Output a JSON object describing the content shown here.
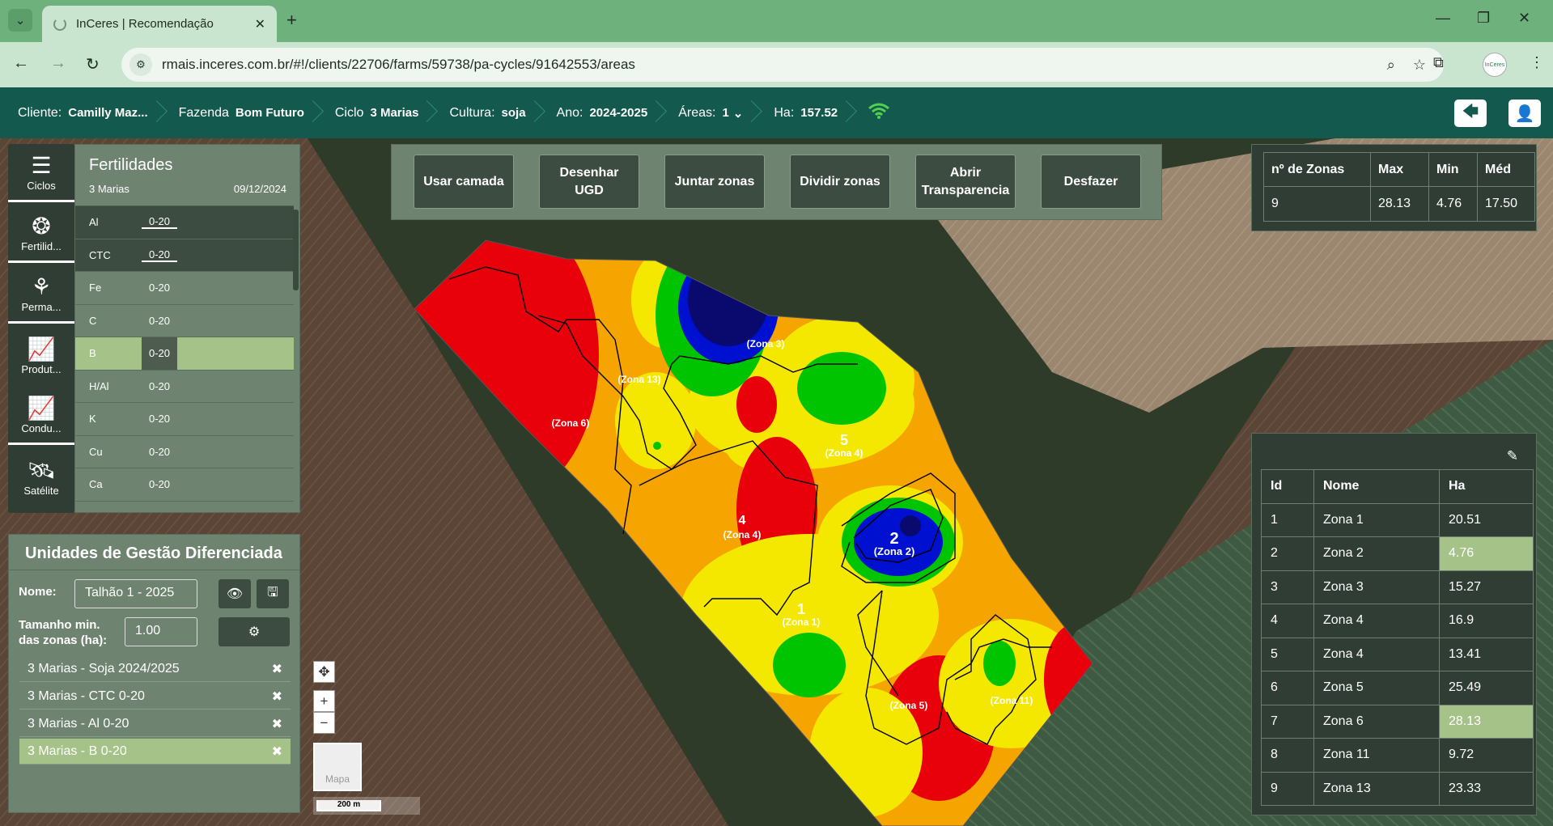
{
  "browser": {
    "tab_title": "InCeres | Recomendação",
    "url": "rmais.inceres.com.br/#!/clients/22706/farms/59738/pa-cycles/91642553/areas",
    "profile_label": "InCeres"
  },
  "header": {
    "cliente_label": "Cliente:",
    "cliente_value": "Camilly Maz...",
    "fazenda_label": "Fazenda",
    "fazenda_value": "Bom Futuro",
    "ciclo_label": "Ciclo",
    "ciclo_value": "3 Marias",
    "cultura_label": "Cultura:",
    "cultura_value": "soja",
    "ano_label": "Ano:",
    "ano_value": "2024-2025",
    "areas_label": "Áreas:",
    "areas_value": "1",
    "ha_label": "Ha:",
    "ha_value": "157.52"
  },
  "leftnav": {
    "items": [
      {
        "label": "Ciclos",
        "icon": "list-icon"
      },
      {
        "label": "Fertilid...",
        "icon": "sprout-icon"
      },
      {
        "label": "Perma...",
        "icon": "plants-icon"
      },
      {
        "label": "Produt...",
        "icon": "chart-icon"
      },
      {
        "label": "Condu...",
        "icon": "chart-icon"
      },
      {
        "label": "Satélite",
        "icon": "satellite-icon"
      }
    ]
  },
  "fertilidades": {
    "title": "Fertilidades",
    "subtitle": "3 Marias",
    "date": "09/12/2024",
    "rows": [
      {
        "name": "Al",
        "depth": "0-20"
      },
      {
        "name": "CTC",
        "depth": "0-20"
      },
      {
        "name": "Fe",
        "depth": "0-20"
      },
      {
        "name": "C",
        "depth": "0-20"
      },
      {
        "name": "B",
        "depth": "0-20"
      },
      {
        "name": "H/Al",
        "depth": "0-20"
      },
      {
        "name": "K",
        "depth": "0-20"
      },
      {
        "name": "Cu",
        "depth": "0-20"
      },
      {
        "name": "Ca",
        "depth": "0-20"
      }
    ]
  },
  "ugd": {
    "title": "Unidades de Gestão Diferenciada",
    "nome_label": "Nome:",
    "nome_value": "Talhão 1 - 2025",
    "tamanho_label_1": "Tamanho min.",
    "tamanho_label_2": "das zonas (ha):",
    "tamanho_value": "1.00",
    "layers": [
      "3 Marias - Soja 2024/2025",
      "3 Marias - CTC 0-20",
      "3 Marias - Al 0-20",
      "3 Marias - B 0-20"
    ]
  },
  "tools": {
    "usar_camada": "Usar camada",
    "desenhar_1": "Desenhar",
    "desenhar_2": "UGD",
    "juntar": "Juntar zonas",
    "dividir": "Dividir zonas",
    "abrir_1": "Abrir",
    "abrir_2": "Transparencia",
    "desfazer": "Desfazer"
  },
  "stats": {
    "headers": [
      "nº de Zonas",
      "Max",
      "Min",
      "Méd"
    ],
    "values": [
      "9",
      "28.13",
      "4.76",
      "17.50"
    ]
  },
  "zones": {
    "headers": [
      "Id",
      "Nome",
      "Ha"
    ],
    "rows": [
      [
        "1",
        "Zona 1",
        "20.51"
      ],
      [
        "2",
        "Zona 2",
        "4.76"
      ],
      [
        "3",
        "Zona 3",
        "15.27"
      ],
      [
        "4",
        "Zona 4",
        "16.9"
      ],
      [
        "5",
        "Zona 4",
        "13.41"
      ],
      [
        "6",
        "Zona 5",
        "25.49"
      ],
      [
        "7",
        "Zona 6",
        "28.13"
      ],
      [
        "8",
        "Zona 11",
        "9.72"
      ],
      [
        "9",
        "Zona 13",
        "23.33"
      ]
    ],
    "highlight_rows": [
      2,
      7
    ]
  },
  "map": {
    "zone_labels": [
      {
        "num": "1",
        "name": "(Zona 1)"
      },
      {
        "num": "2",
        "name": "(Zona 2)"
      },
      {
        "num": "4",
        "name": "(Zona 4)"
      },
      {
        "num": "5",
        "name": "(Zona 4)"
      },
      {
        "num": "",
        "name": "(Zona 5)"
      },
      {
        "num": "",
        "name": "(Zona 6)"
      },
      {
        "num": "",
        "name": "(Zona 13)"
      },
      {
        "num": "",
        "name": "(Zona 11)"
      },
      {
        "num": "",
        "name": "(Zona 3)"
      }
    ],
    "minimap_label": "Mapa",
    "scale_label": "200 m"
  }
}
